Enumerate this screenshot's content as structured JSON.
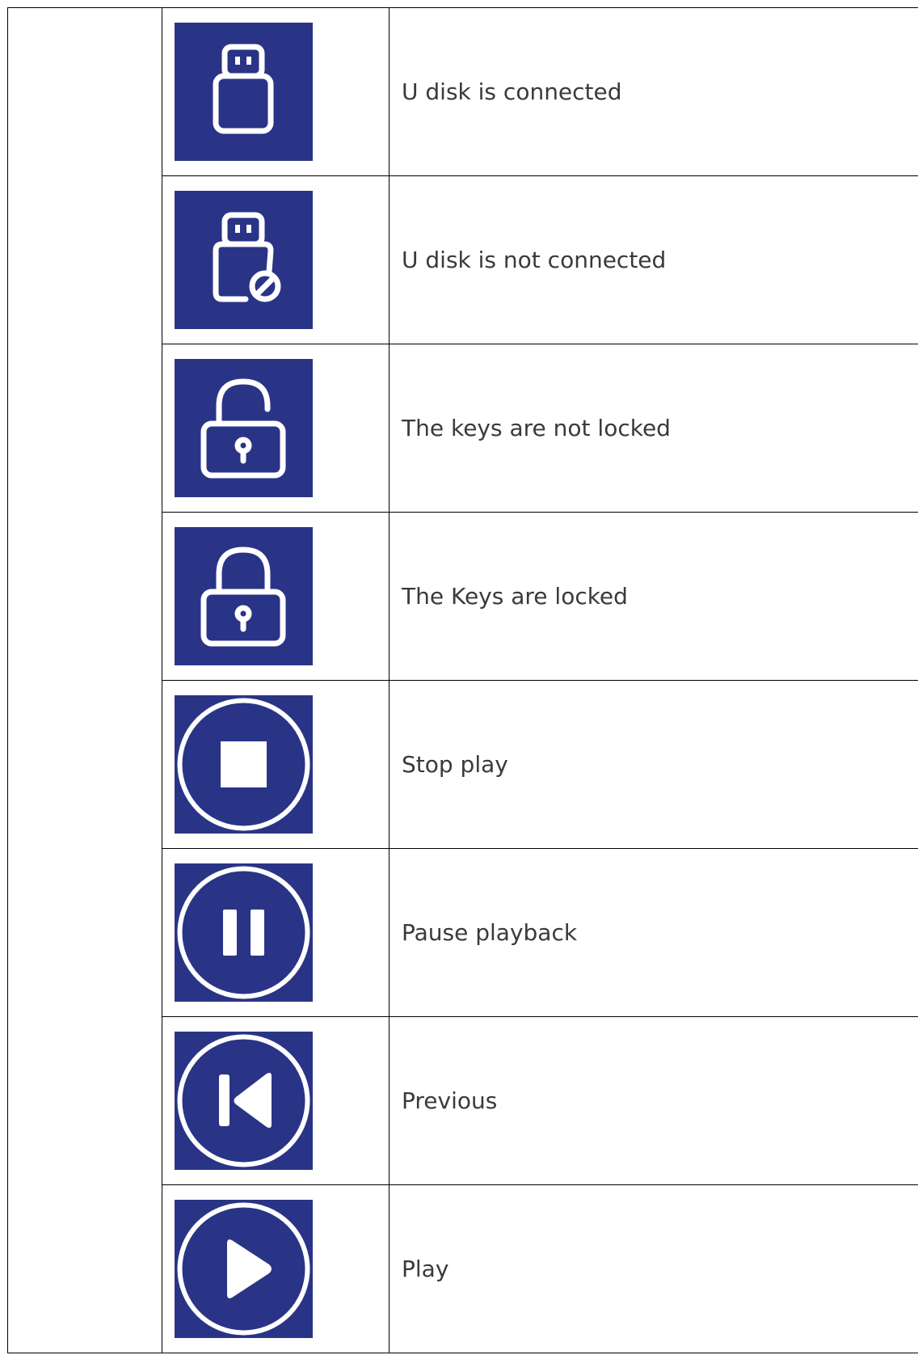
{
  "colors": {
    "icon_background": "#2a3486",
    "icon_stroke": "#ffffff",
    "text": "#3a3a3a",
    "border": "#000000"
  },
  "rows": [
    {
      "icon": "usb-drive-icon",
      "label": "U disk is connected"
    },
    {
      "icon": "usb-drive-disconnected-icon",
      "label": "U disk is not connected"
    },
    {
      "icon": "padlock-unlocked-icon",
      "label": "The keys are not locked"
    },
    {
      "icon": "padlock-locked-icon",
      "label": "The Keys are locked"
    },
    {
      "icon": "stop-circle-icon",
      "label": "Stop play"
    },
    {
      "icon": "pause-circle-icon",
      "label": "Pause playback"
    },
    {
      "icon": "previous-circle-icon",
      "label": "Previous"
    },
    {
      "icon": "play-circle-icon",
      "label": "Play"
    }
  ]
}
